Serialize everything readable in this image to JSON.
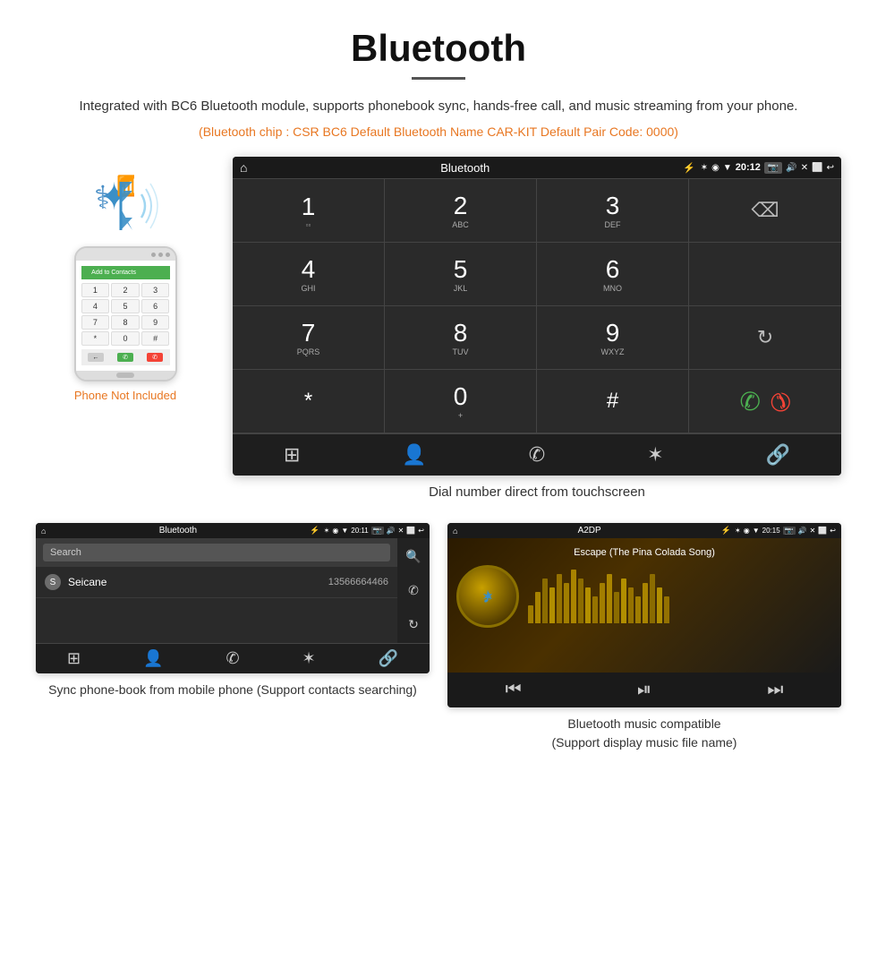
{
  "header": {
    "title": "Bluetooth",
    "subtitle": "Integrated with BC6 Bluetooth module, supports phonebook sync, hands-free call, and music streaming from your phone.",
    "specs": "(Bluetooth chip : CSR BC6    Default Bluetooth Name CAR-KIT    Default Pair Code: 0000)"
  },
  "phone_area": {
    "not_included_label": "Phone Not Included"
  },
  "main_screen": {
    "status_bar": {
      "title": "Bluetooth",
      "time": "20:12"
    },
    "keypad": [
      {
        "num": "1",
        "letters": ""
      },
      {
        "num": "2",
        "letters": "ABC"
      },
      {
        "num": "3",
        "letters": "DEF"
      },
      {
        "num": "",
        "letters": "backspace"
      },
      {
        "num": "4",
        "letters": "GHI"
      },
      {
        "num": "5",
        "letters": "JKL"
      },
      {
        "num": "6",
        "letters": "MNO"
      },
      {
        "num": "",
        "letters": "empty"
      },
      {
        "num": "7",
        "letters": "PQRS"
      },
      {
        "num": "8",
        "letters": "TUV"
      },
      {
        "num": "9",
        "letters": "WXYZ"
      },
      {
        "num": "",
        "letters": "sync"
      },
      {
        "num": "*",
        "letters": ""
      },
      {
        "num": "0",
        "letters": "+"
      },
      {
        "num": "#",
        "letters": ""
      },
      {
        "num": "",
        "letters": "calls"
      }
    ],
    "caption": "Dial number direct from touchscreen"
  },
  "phonebook_screen": {
    "status_bar": {
      "title": "Bluetooth",
      "time": "20:11"
    },
    "search_placeholder": "Search",
    "contacts": [
      {
        "letter": "S",
        "name": "Seicane",
        "number": "13566664466"
      }
    ],
    "caption": "Sync phone-book from mobile phone\n(Support contacts searching)"
  },
  "music_screen": {
    "status_bar": {
      "title": "A2DP",
      "time": "20:15"
    },
    "song_title": "Escape (The Pina Colada Song)",
    "eq_bars": [
      20,
      35,
      50,
      40,
      55,
      45,
      60,
      50,
      40,
      30,
      45,
      55,
      35,
      50,
      40,
      30,
      45,
      55,
      40,
      30
    ],
    "caption": "Bluetooth music compatible\n(Support display music file name)"
  },
  "icons": {
    "home": "⌂",
    "bluetooth": "⚡",
    "back": "↩",
    "camera": "📷",
    "volume": "🔊",
    "search": "🔍",
    "phone_call": "📞",
    "contacts": "👤",
    "keypad_grid": "⊞",
    "link": "🔗",
    "skip_back": "⏮",
    "play_pause": "⏯",
    "skip_fwd": "⏭"
  }
}
